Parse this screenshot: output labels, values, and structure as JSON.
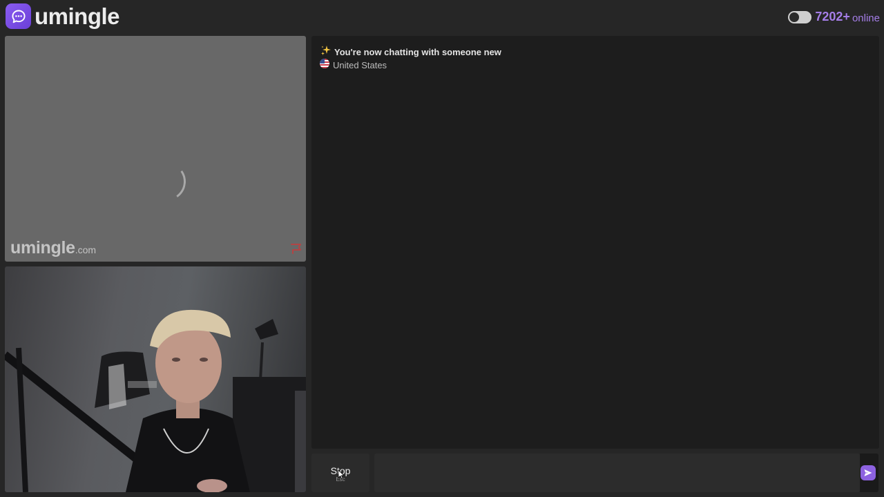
{
  "header": {
    "logo_text": "umingle",
    "online_count": "7202+",
    "online_label": "online",
    "accent_color": "#a57ee8"
  },
  "stranger_video": {
    "watermark_main": "umingle",
    "watermark_suffix": ".com",
    "loading_icon": "spinner-icon",
    "report_icon": "report-flag-icon"
  },
  "chat": {
    "system_title": "You're now chatting with someone new",
    "title_icon": "sparkles-icon",
    "country": "United States",
    "country_icon": "us-flag-icon"
  },
  "controls": {
    "stop_label": "Stop",
    "stop_key": "Esc",
    "message_value": "",
    "send_icon": "send-icon"
  }
}
